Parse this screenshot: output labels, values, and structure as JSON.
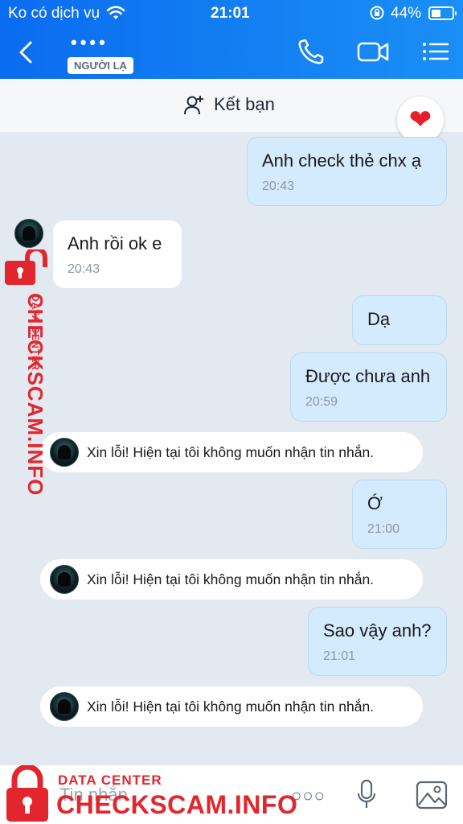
{
  "status_bar": {
    "carrier": "Ko có dịch vụ",
    "time": "21:01",
    "battery": "44%"
  },
  "header": {
    "contact_name": "••••",
    "badge": "NGƯỜI LẠ"
  },
  "friend_bar": {
    "label": "Kết bạn"
  },
  "messages": [
    {
      "from": "me",
      "text": "Anh check thẻ chx ạ",
      "time": "20:43"
    },
    {
      "from": "them",
      "text": "Anh rồi ok e",
      "time": "20:43"
    },
    {
      "from": "me",
      "text": "Dạ",
      "time": ""
    },
    {
      "from": "me",
      "text": "Được chưa anh",
      "time": "20:59"
    },
    {
      "from": "system",
      "text": "Xin lỗi! Hiện tại tôi không muốn nhận tin nhắn."
    },
    {
      "from": "me",
      "text": "Ớ",
      "time": "21:00"
    },
    {
      "from": "system",
      "text": "Xin lỗi! Hiện tại tôi không muốn nhận tin nhắn."
    },
    {
      "from": "me",
      "text": "Sao vậy anh?",
      "time": "21:01"
    },
    {
      "from": "system",
      "text": "Xin lỗi! Hiện tại tôi không muốn nhận tin nhắn."
    }
  ],
  "composer": {
    "placeholder": "Tin nhắn"
  },
  "watermark": {
    "sub": "DATA CENTER",
    "main": "CHECKSCAM.INFO"
  },
  "colors": {
    "header": "#0a6cf0",
    "my_bubble": "#d4eafd",
    "background": "#e2e9f1",
    "watermark": "#e3262e"
  }
}
